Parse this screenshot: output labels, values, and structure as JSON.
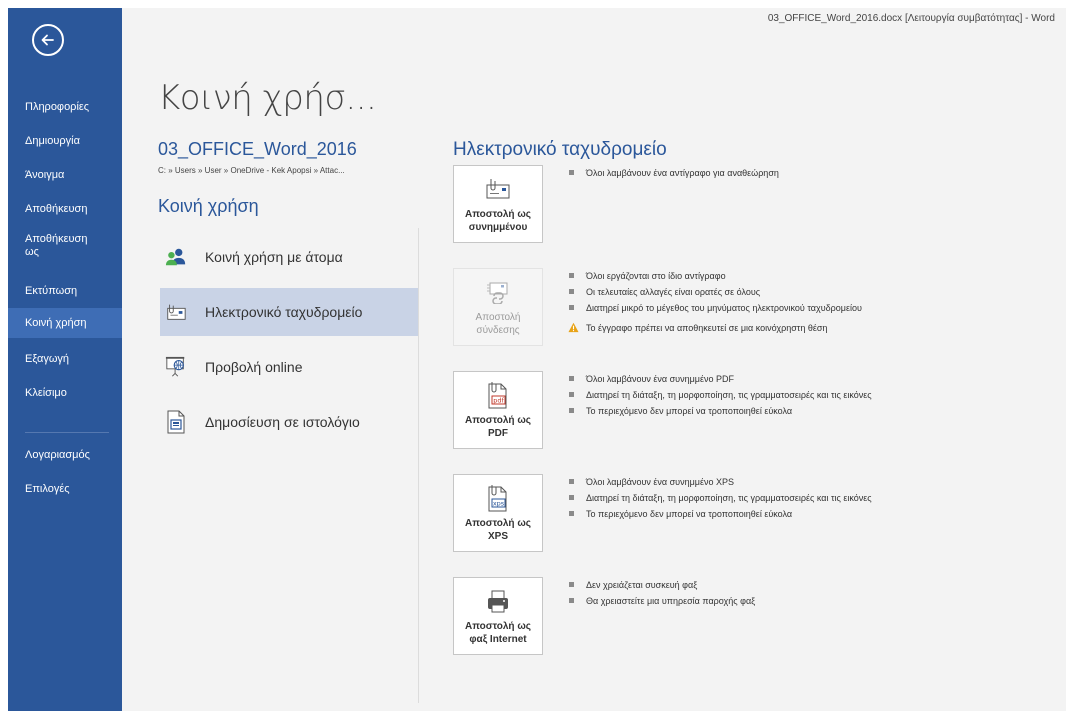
{
  "window": {
    "title": "03_OFFICE_Word_2016.docx [Λειτουργία συμβατότητας] - Word"
  },
  "sidebar": {
    "back_icon": "back-arrow-icon",
    "items": [
      {
        "label": "Πληροφορίες"
      },
      {
        "label": "Δημιουργία"
      },
      {
        "label": "Άνοιγμα"
      },
      {
        "label": "Αποθήκευση"
      },
      {
        "label": "Αποθήκευση ως"
      },
      {
        "label": "Εκτύπωση"
      },
      {
        "label": "Κοινή χρήση"
      },
      {
        "label": "Εξαγωγή"
      },
      {
        "label": "Κλείσιμο"
      },
      {
        "label": "Λογαριασμός"
      },
      {
        "label": "Επιλογές"
      }
    ],
    "active_item": "Κοινή χρήση",
    "background": "#2b579a"
  },
  "main": {
    "heading": "Κοινή χρήσ...",
    "document_name": "03_OFFICE_Word_2016",
    "document_path": "C: » Users » User » OneDrive - Kek Apopsi » Attac...",
    "section_heading": "Κοινή χρήση",
    "share_options": [
      {
        "label": "Κοινή χρήση με άτομα",
        "icon": "people-icon"
      },
      {
        "label": "Ηλεκτρονικό ταχυδρομείο",
        "icon": "email-icon"
      },
      {
        "label": "Προβολή online",
        "icon": "present-online-icon"
      },
      {
        "label": "Δημοσίευση σε ιστολόγιο",
        "icon": "blog-icon"
      }
    ],
    "active_option": "Ηλεκτρονικό ταχυδρομείο"
  },
  "email_panel": {
    "heading": "Ηλεκτρονικό ταχυδρομείο",
    "actions": [
      {
        "label": "Αποστολή ως συνημμένου",
        "icon": "attachment-icon",
        "enabled": true,
        "bullets": [
          "Όλοι λαμβάνουν ένα αντίγραφο για αναθεώρηση"
        ]
      },
      {
        "label": "Αποστολή σύνδεσης",
        "icon": "link-icon",
        "enabled": false,
        "bullets": [
          "Όλοι εργάζονται στο ίδιο αντίγραφο",
          "Οι τελευταίες αλλαγές είναι ορατές σε όλους",
          "Διατηρεί μικρό το μέγεθος του μηνύματος ηλεκτρονικού ταχυδρομείου"
        ],
        "warning": "Το έγγραφο πρέπει να αποθηκευτεί σε μια κοινόχρηστη θέση"
      },
      {
        "label": "Αποστολή ως PDF",
        "icon": "pdf-icon",
        "enabled": true,
        "bullets": [
          "Όλοι λαμβάνουν ένα συνημμένο PDF",
          "Διατηρεί τη διάταξη, τη μορφοποίηση, τις γραμματοσειρές και τις εικόνες",
          "Το περιεχόμενο δεν μπορεί να τροποποιηθεί εύκολα"
        ]
      },
      {
        "label": "Αποστολή ως XPS",
        "icon": "xps-icon",
        "enabled": true,
        "bullets": [
          "Όλοι λαμβάνουν ένα συνημμένο XPS",
          "Διατηρεί τη διάταξη, τη μορφοποίηση, τις γραμματοσειρές και τις εικόνες",
          "Το περιεχόμενο δεν μπορεί να τροποποιηθεί εύκολα"
        ]
      },
      {
        "label": "Αποστολή ως φαξ Internet",
        "icon": "fax-icon",
        "enabled": true,
        "bullets": [
          "Δεν χρειάζεται συσκευή φαξ",
          "Θα χρειαστείτε μια υπηρεσία παροχής φαξ"
        ]
      }
    ]
  },
  "colors": {
    "accent": "#2b579a",
    "active_option_bg": "#c9d3e6",
    "warning": "#e8a317"
  },
  "labels_split": {
    "btn1": [
      "Αποστολή ως",
      "συνημμένου"
    ],
    "btn2": [
      "Αποστολή",
      "σύνδεσης"
    ],
    "btn3": [
      "Αποστολή ως",
      "PDF"
    ],
    "btn4": [
      "Αποστολή ως",
      "XPS"
    ],
    "btn5": [
      "Αποστολή ως",
      "φαξ Internet"
    ],
    "nav_save_as": [
      "Αποθήκευση",
      "ως"
    ]
  }
}
